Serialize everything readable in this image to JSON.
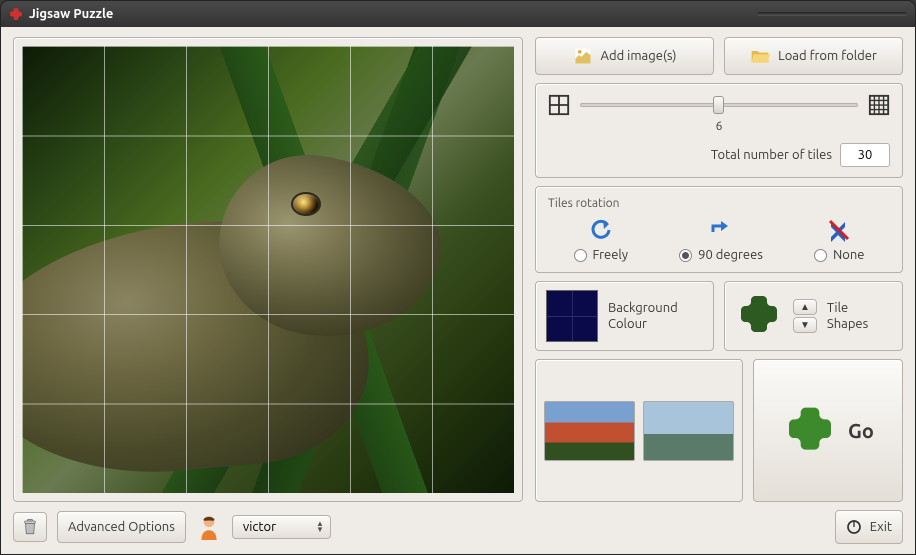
{
  "window": {
    "title": "Jigsaw Puzzle"
  },
  "buttons": {
    "add_images": "Add image(s)",
    "load_folder": "Load from folder",
    "advanced": "Advanced Options",
    "exit": "Exit",
    "go": "Go"
  },
  "slider": {
    "value": "6",
    "total_label": "Total number of tiles",
    "total_value": "30"
  },
  "rotation": {
    "title": "Tiles rotation",
    "options": {
      "freely": "Freely",
      "ninety": "90 degrees",
      "none": "None"
    },
    "selected": "ninety"
  },
  "bg_colour": {
    "label_line1": "Background",
    "label_line2": "Colour",
    "hex": "#0a0a4a"
  },
  "tile_shapes": {
    "label_line1": "Tile",
    "label_line2": "Shapes"
  },
  "user": {
    "name": "victor"
  }
}
